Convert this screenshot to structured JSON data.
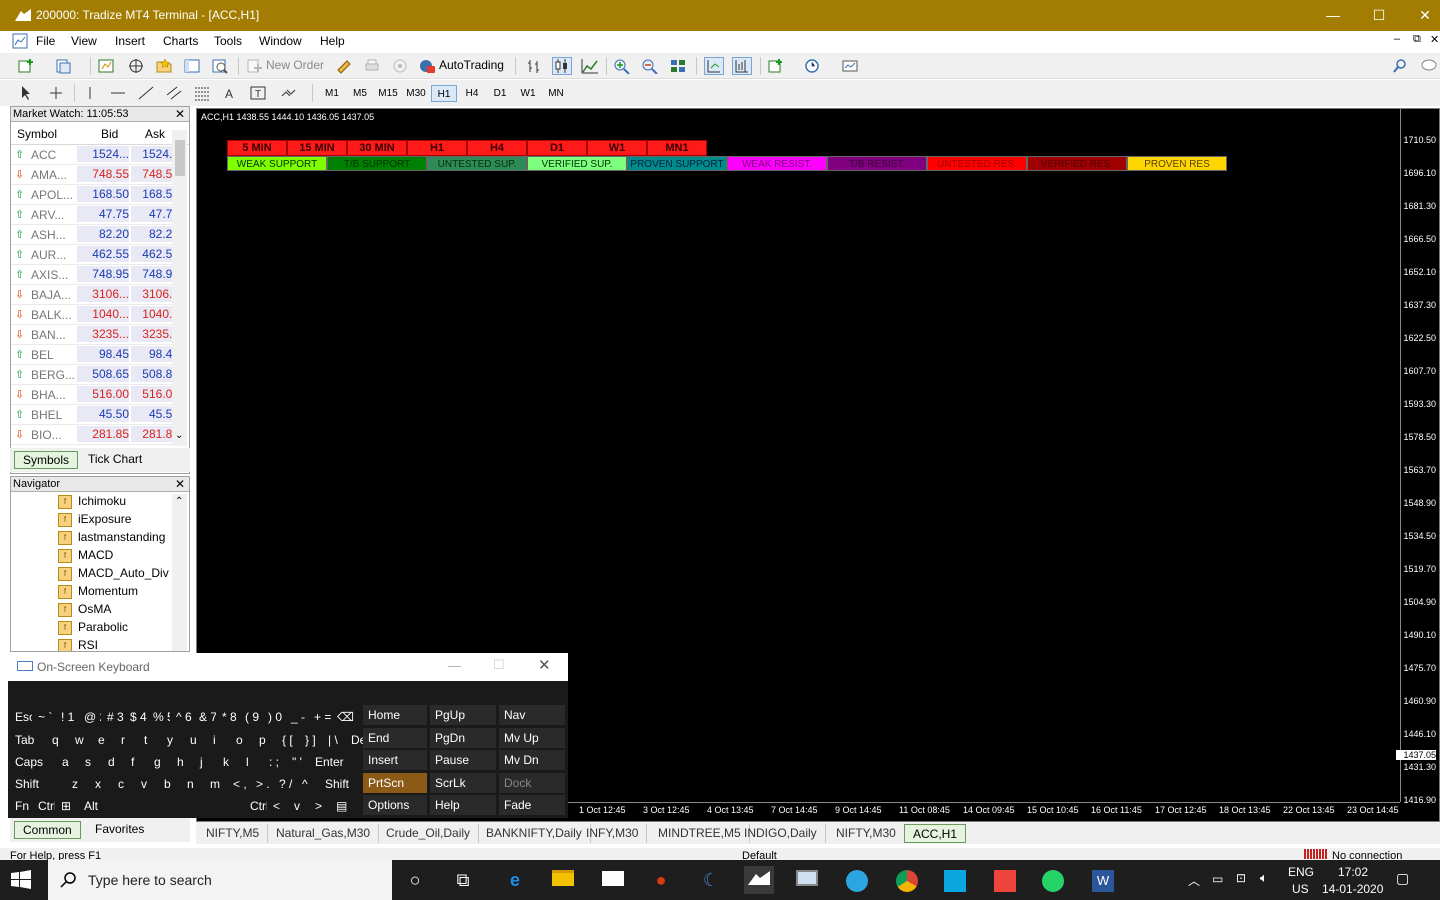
{
  "window": {
    "title": "200000: Tradize MT4 Terminal - [ACC,H1]",
    "min_label": "—",
    "max_label": "☐",
    "close_label": "✕"
  },
  "menu": [
    "File",
    "View",
    "Insert",
    "Charts",
    "Tools",
    "Window",
    "Help"
  ],
  "mdi_controls": [
    "–",
    "⧉",
    "✕"
  ],
  "toolbar": {
    "new_order": "New Order",
    "autotrading": "AutoTrading"
  },
  "timeframes": [
    "M1",
    "M5",
    "M15",
    "M30",
    "H1",
    "H4",
    "D1",
    "W1",
    "MN"
  ],
  "active_timeframe": "H1",
  "market_watch": {
    "title": "Market Watch: 11:05:53",
    "columns": {
      "symbol": "Symbol",
      "bid": "Bid",
      "ask": "Ask"
    },
    "rows": [
      {
        "symbol": "ACC",
        "bid": "1524...",
        "ask": "1524...",
        "dir": "up"
      },
      {
        "symbol": "AMA...",
        "bid": "748.55",
        "ask": "748.55",
        "dir": "dn"
      },
      {
        "symbol": "APOL...",
        "bid": "168.50",
        "ask": "168.50",
        "dir": "up"
      },
      {
        "symbol": "ARV...",
        "bid": "47.75",
        "ask": "47.75",
        "dir": "up"
      },
      {
        "symbol": "ASH...",
        "bid": "82.20",
        "ask": "82.20",
        "dir": "up"
      },
      {
        "symbol": "AUR...",
        "bid": "462.55",
        "ask": "462.55",
        "dir": "up"
      },
      {
        "symbol": "AXIS...",
        "bid": "748.95",
        "ask": "748.95",
        "dir": "up"
      },
      {
        "symbol": "BAJA...",
        "bid": "3106...",
        "ask": "3106...",
        "dir": "dn"
      },
      {
        "symbol": "BALK...",
        "bid": "1040...",
        "ask": "1040...",
        "dir": "dn"
      },
      {
        "symbol": "BAN...",
        "bid": "3235...",
        "ask": "3235...",
        "dir": "dn"
      },
      {
        "symbol": "BEL",
        "bid": "98.45",
        "ask": "98.45",
        "dir": "up"
      },
      {
        "symbol": "BERG...",
        "bid": "508.65",
        "ask": "508.85",
        "dir": "up"
      },
      {
        "symbol": "BHA...",
        "bid": "516.00",
        "ask": "516.00",
        "dir": "dn"
      },
      {
        "symbol": "BHEL",
        "bid": "45.50",
        "ask": "45.50",
        "dir": "up"
      },
      {
        "symbol": "BIO...",
        "bid": "281.85",
        "ask": "281.85",
        "dir": "dn"
      }
    ],
    "tabs": [
      "Symbols",
      "Tick Chart"
    ]
  },
  "navigator": {
    "title": "Navigator",
    "items": [
      "Ichimoku",
      "iExposure",
      "lastmanstanding",
      "MACD",
      "MACD_Auto_Div",
      "Momentum",
      "OsMA",
      "Parabolic",
      "RSI"
    ],
    "tabs": [
      "Common",
      "Favorites"
    ]
  },
  "chart": {
    "info": "ACC,H1  1438.55 1444.10 1436.05 1437.05",
    "tf_buttons": [
      "5 MIN",
      "15 MIN",
      "30 MIN",
      "H1",
      "H4",
      "D1",
      "W1",
      "MN1"
    ],
    "legend": [
      {
        "label": "WEAK SUPPORT",
        "bg": "#7fff00",
        "fg": "#003300"
      },
      {
        "label": "T/B SUPPORT",
        "bg": "#008000",
        "fg": "#003300"
      },
      {
        "label": "UNTESTED SUP.",
        "bg": "#2e8b57",
        "fg": "#003300"
      },
      {
        "label": "VERIFIED SUP.",
        "bg": "#7fff7f",
        "fg": "#003300"
      },
      {
        "label": "PROVEN SUPPORT",
        "bg": "#008b8b",
        "fg": "#002040"
      },
      {
        "label": "WEAK RESIST.",
        "bg": "#ff00ff",
        "fg": "#7a007a"
      },
      {
        "label": "T/B RESIST.",
        "bg": "#800080",
        "fg": "#3a003a"
      },
      {
        "label": "UNTESTED RES.",
        "bg": "#ff0000",
        "fg": "#a00000"
      },
      {
        "label": "VERIFIED RES.",
        "bg": "#a00000",
        "fg": "#500000"
      },
      {
        "label": "PROVEN RES",
        "bg": "#ffd700",
        "fg": "#5a4000"
      }
    ],
    "price_labels": [
      "1710.50",
      "1696.10",
      "1681.30",
      "1666.50",
      "1652.10",
      "1637.30",
      "1622.50",
      "1607.70",
      "1593.30",
      "1578.50",
      "1563.70",
      "1548.90",
      "1534.50",
      "1519.70",
      "1504.90",
      "1490.10",
      "1475.70",
      "1460.90",
      "1446.10",
      "1437.05",
      "1431.30",
      "1416.90"
    ],
    "current_price": "1437.05",
    "time_labels": [
      "1 Oct 12:45",
      "3 Oct 12:45",
      "4 Oct 13:45",
      "7 Oct 14:45",
      "9 Oct 14:45",
      "11 Oct 08:45",
      "14 Oct 09:45",
      "15 Oct 10:45",
      "16 Oct 11:45",
      "17 Oct 12:45",
      "18 Oct 13:45",
      "22 Oct 13:45",
      "23 Oct 14:45"
    ]
  },
  "chart_tabs": [
    "NIFTY,M5",
    "Natural_Gas,M30",
    "Crude_Oil,Daily",
    "BANKNIFTY,Daily",
    "INFY,M30",
    "MINDTREE,M5",
    "INDIGO,Daily",
    "NIFTY,M30",
    "ACC,H1"
  ],
  "active_chart_tab": "ACC,H1",
  "status": {
    "help": "For Help, press F1",
    "profile": "Default",
    "connection": "No connection"
  },
  "osk": {
    "title": "On-Screen Keyboard",
    "row1": [
      "Esc",
      "~ `",
      "! 1",
      "@ 2",
      "# 3",
      "$ 4",
      "% 5",
      "^ 6",
      "& 7",
      "* 8",
      "( 9",
      ") 0",
      "_ -",
      "+ =",
      "⌫"
    ],
    "row2": [
      "Tab",
      "q",
      "w",
      "e",
      "r",
      "t",
      "y",
      "u",
      "i",
      "o",
      "p",
      "{ [",
      "} ]",
      "| \\",
      "Del"
    ],
    "row3": [
      "Caps",
      "a",
      "s",
      "d",
      "f",
      "g",
      "h",
      "j",
      "k",
      "l",
      ": ;",
      "\" '",
      "Enter"
    ],
    "row4": [
      "Shift",
      "z",
      "x",
      "c",
      "v",
      "b",
      "n",
      "m",
      "< ,",
      "> .",
      "? /",
      "^",
      "Shift"
    ],
    "row5": [
      "Fn",
      "Ctrl",
      "⊞",
      "Alt",
      "Alt",
      "Ctrl",
      "<",
      "v",
      ">",
      "▤"
    ],
    "right": [
      [
        "Home",
        "PgUp",
        "Nav"
      ],
      [
        "End",
        "PgDn",
        "Mv Up"
      ],
      [
        "Insert",
        "Pause",
        "Mv Dn"
      ],
      [
        "PrtScn",
        "ScrLk",
        "Dock"
      ],
      [
        "Options",
        "Help",
        "Fade"
      ]
    ]
  },
  "taskbar": {
    "search_placeholder": "Type here to search",
    "lang": "ENG",
    "region": "US",
    "time": "17:02",
    "date": "14-01-2020"
  }
}
